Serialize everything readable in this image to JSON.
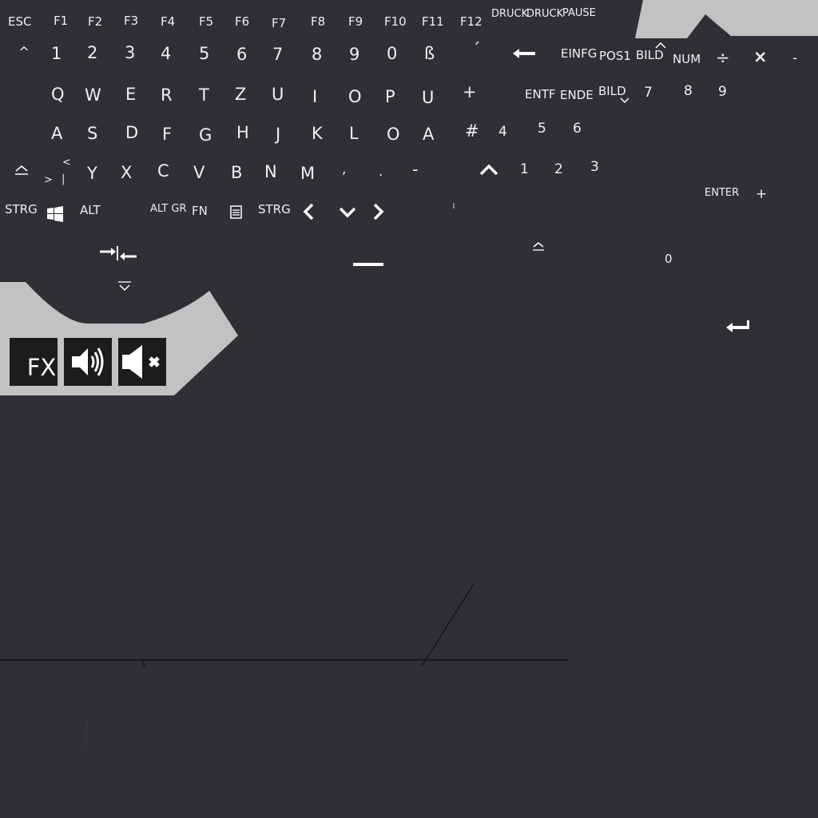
{
  "row_function": {
    "esc": "ESC",
    "f1": "F1",
    "f2": "F2",
    "f3": "F3",
    "f4": "F4",
    "f5": "F5",
    "f6": "F6",
    "f7": "F7",
    "f8": "F8",
    "f9": "F9",
    "f10": "F10",
    "f11": "F11",
    "f12": "F12",
    "druck1": "DRUCK",
    "druck2": "DRUCK",
    "pause": "PAUSE"
  },
  "row_number": {
    "caret": "^",
    "n1": "1",
    "n2": "2",
    "n3": "3",
    "n4": "4",
    "n5": "5",
    "n6": "6",
    "n7": "7",
    "n8": "8",
    "n9": "9",
    "n0": "0",
    "sz": "ß",
    "acute": "´",
    "einfg": "EINFG",
    "pos1": "POS1",
    "bild_up": "BILD",
    "num": "NUM",
    "divide": "÷",
    "multiply": "×",
    "minus": "-"
  },
  "row_qwertz": {
    "q": "Q",
    "w": "W",
    "e": "E",
    "r": "R",
    "t": "T",
    "z": "Z",
    "u": "U",
    "i": "I",
    "o": "O",
    "p": "P",
    "ue": "U",
    "plus": "+",
    "entf": "ENTF",
    "ende": "ENDE",
    "bild_down": "BILD",
    "np7": "7",
    "np8": "8",
    "np9": "9"
  },
  "row_asdf": {
    "a": "A",
    "s": "S",
    "d": "D",
    "f": "F",
    "g": "G",
    "h": "H",
    "j": "J",
    "k": "K",
    "l": "L",
    "oe": "O",
    "ae": "A",
    "hash": "#",
    "np4": "4",
    "np5": "5",
    "np6": "6"
  },
  "row_yxcv": {
    "lt": "<",
    "gt": ">",
    "pipe": "|",
    "y": "Y",
    "x": "X",
    "c": "C",
    "v": "V",
    "b": "B",
    "n": "N",
    "m": "M",
    "comma": ",",
    "period": ".",
    "dash": "-",
    "np1": "1",
    "np2": "2",
    "np3": "3",
    "enter": "ENTER",
    "np_plus": "+"
  },
  "row_bottom": {
    "strg_left": "STRG",
    "alt": "ALT",
    "altgr": "ALT GR",
    "fn": "FN",
    "strg_right": "STRG",
    "np0": "0"
  },
  "media": {
    "fx": "FX"
  },
  "colors": {
    "background": "#312e35",
    "panel": "#c2c2c2",
    "button": "#1c1b1e",
    "text": "#f0f0f0"
  }
}
